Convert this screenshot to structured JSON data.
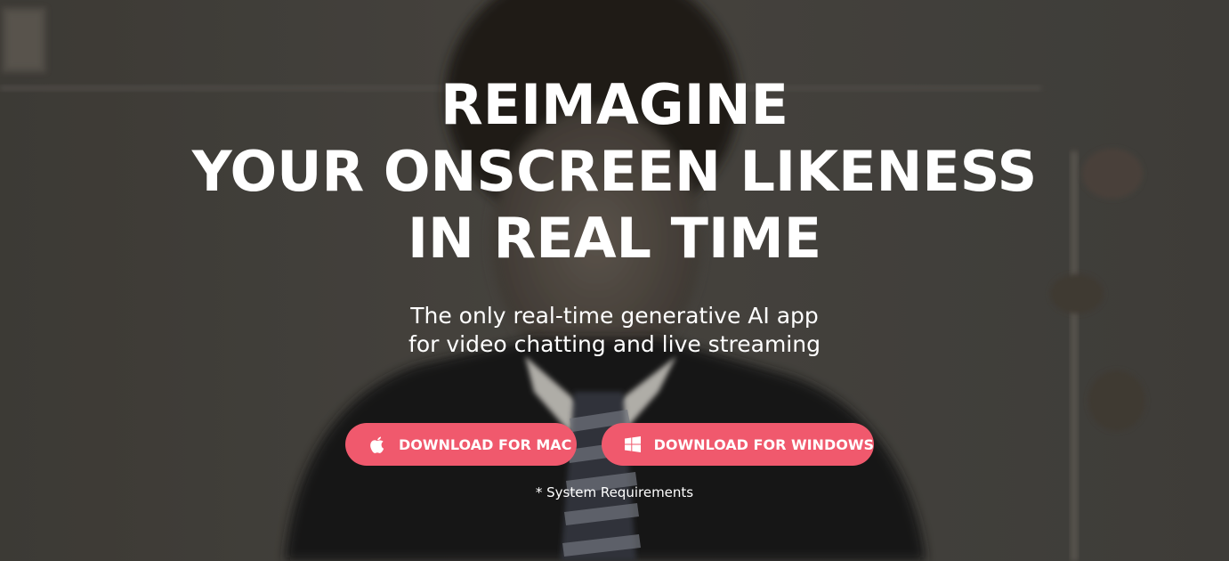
{
  "hero": {
    "headline_lines": [
      "REIMAGINE",
      "YOUR ONSCREEN LIKENESS",
      "IN REAL TIME"
    ],
    "subtitle_lines": [
      "The only real-time generative AI app",
      "for video chatting and live streaming"
    ],
    "background_image": "blurred video still of a person in a dark suit and striped tie"
  },
  "buttons": {
    "mac": {
      "label": "DOWNLOAD FOR MAC",
      "icon": "apple-icon"
    },
    "windows": {
      "label": "DOWNLOAD FOR WINDOWS",
      "icon": "windows-icon"
    }
  },
  "system_requirements_link": "* System Requirements",
  "colors": {
    "button_accent": "#f0596d",
    "text": "#ffffff",
    "background_dark": "#3a3835"
  }
}
